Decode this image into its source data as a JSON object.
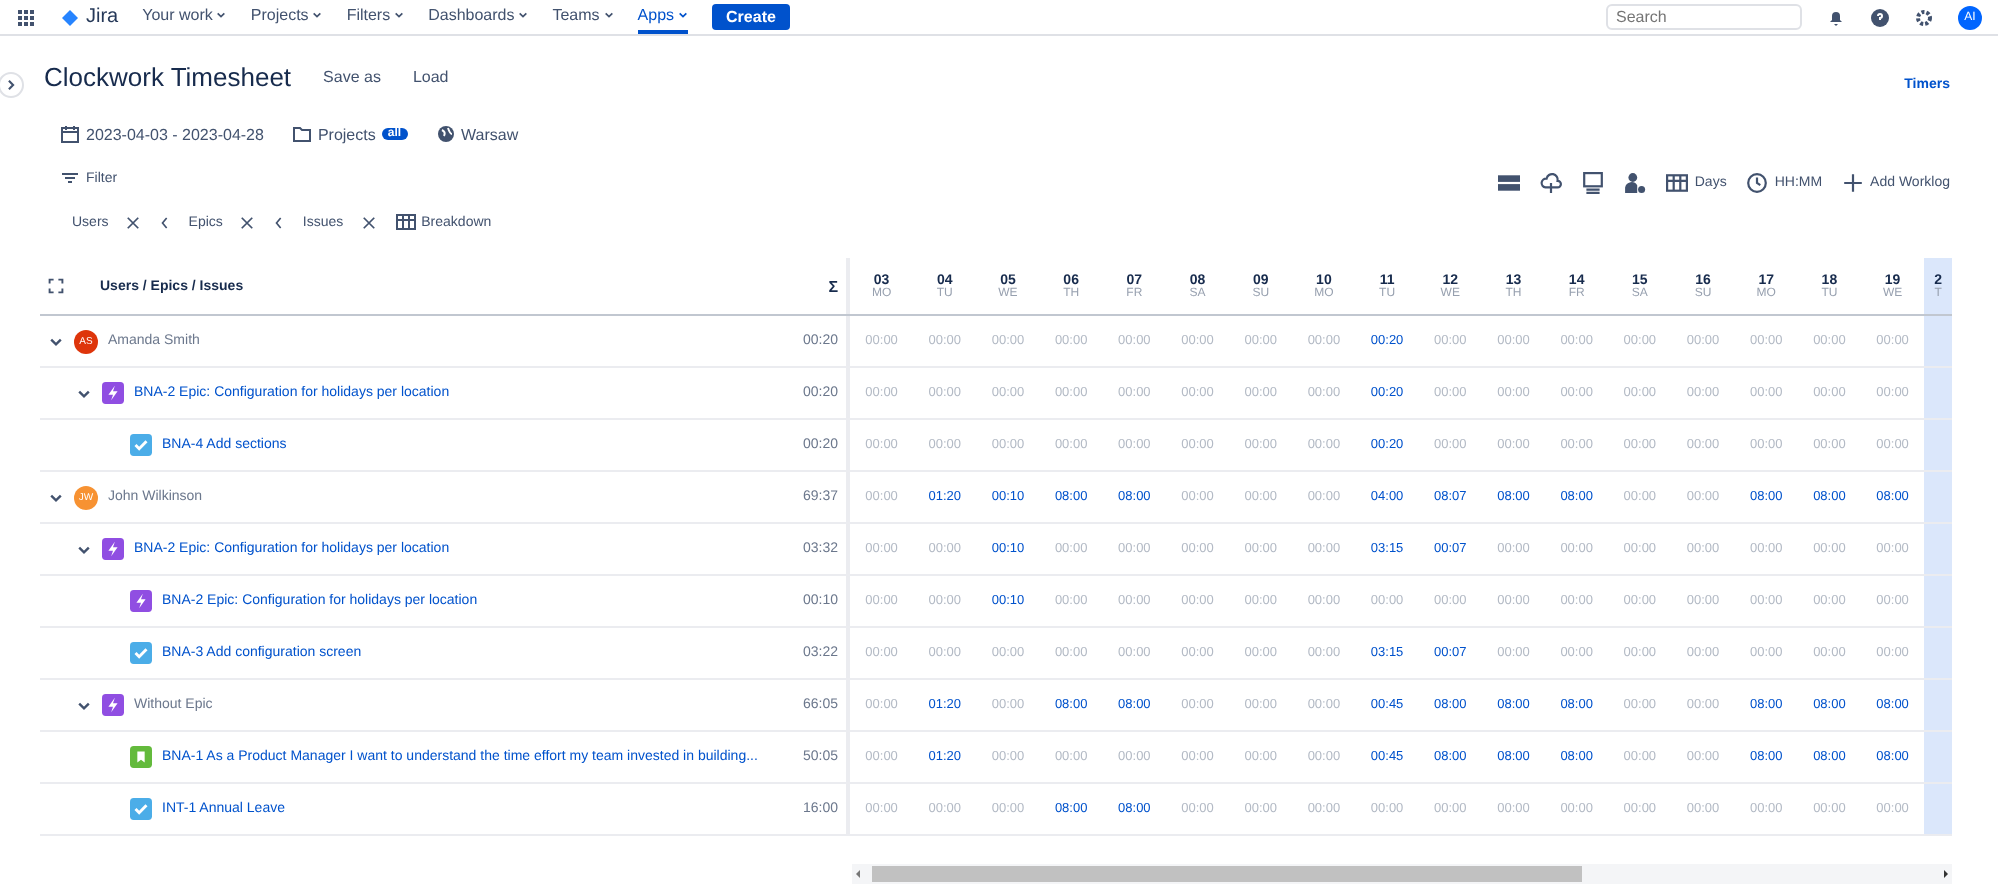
{
  "nav": {
    "product": "Jira",
    "items": [
      {
        "label": "Your work",
        "selected": false
      },
      {
        "label": "Projects",
        "selected": false
      },
      {
        "label": "Filters",
        "selected": false
      },
      {
        "label": "Dashboards",
        "selected": false
      },
      {
        "label": "Teams",
        "selected": false
      },
      {
        "label": "Apps",
        "selected": true
      }
    ],
    "create": "Create",
    "search": {
      "placeholder": "Search"
    },
    "avatar": "AI"
  },
  "header": {
    "title": "Clockwork Timesheet",
    "actions": [
      "Save as",
      "Load"
    ],
    "timers": "Timers"
  },
  "scope": {
    "date_range": "2023-04-03 - 2023-04-28",
    "projects": "Projects",
    "projects_badge": "all",
    "timezone": "Warsaw"
  },
  "filter": "Filter",
  "chips": [
    {
      "label": "Users",
      "has_arrow": false
    },
    {
      "label": "Epics",
      "has_arrow": true
    },
    {
      "label": "Issues",
      "has_arrow": true
    }
  ],
  "breakdown": "Breakdown",
  "toolbar": {
    "days": "Days",
    "format": "HH:MM",
    "add": "Add Worklog"
  },
  "table": {
    "heading": "Users / Epics / Issues",
    "sum_symbol": "Σ",
    "days": [
      {
        "day": "03",
        "weekday": "MO",
        "today": false
      },
      {
        "day": "04",
        "weekday": "TU",
        "today": false
      },
      {
        "day": "05",
        "weekday": "WE",
        "today": false
      },
      {
        "day": "06",
        "weekday": "TH",
        "today": false
      },
      {
        "day": "07",
        "weekday": "FR",
        "today": false
      },
      {
        "day": "08",
        "weekday": "SA",
        "today": false
      },
      {
        "day": "09",
        "weekday": "SU",
        "today": false
      },
      {
        "day": "10",
        "weekday": "MO",
        "today": false
      },
      {
        "day": "11",
        "weekday": "TU",
        "today": false
      },
      {
        "day": "12",
        "weekday": "WE",
        "today": false
      },
      {
        "day": "13",
        "weekday": "TH",
        "today": false
      },
      {
        "day": "14",
        "weekday": "FR",
        "today": false
      },
      {
        "day": "15",
        "weekday": "SA",
        "today": false
      },
      {
        "day": "16",
        "weekday": "SU",
        "today": false
      },
      {
        "day": "17",
        "weekday": "MO",
        "today": false
      },
      {
        "day": "18",
        "weekday": "TU",
        "today": false
      },
      {
        "day": "19",
        "weekday": "WE",
        "today": false
      },
      {
        "day": "2",
        "weekday": "T",
        "today": true
      }
    ],
    "rows": [
      {
        "kind": "user",
        "title": "Amanda Smith",
        "initials": "AS",
        "color": "#de350b",
        "total": "00:20",
        "expanded": true,
        "cells": [
          {
            "time": "00:00",
            "logged": false
          },
          {
            "time": "00:00",
            "logged": false
          },
          {
            "time": "00:00",
            "logged": false
          },
          {
            "time": "00:00",
            "logged": false
          },
          {
            "time": "00:00",
            "logged": false
          },
          {
            "time": "00:00",
            "logged": false
          },
          {
            "time": "00:00",
            "logged": false
          },
          {
            "time": "00:00",
            "logged": false
          },
          {
            "time": "00:20",
            "logged": true
          },
          {
            "time": "00:00",
            "logged": false
          },
          {
            "time": "00:00",
            "logged": false
          },
          {
            "time": "00:00",
            "logged": false
          },
          {
            "time": "00:00",
            "logged": false
          },
          {
            "time": "00:00",
            "logged": false
          },
          {
            "time": "00:00",
            "logged": false
          },
          {
            "time": "00:00",
            "logged": false
          },
          {
            "time": "00:00",
            "logged": false
          }
        ],
        "children": [
          {
            "kind": "epic",
            "title": "BNA-2 Epic: Configuration for holidays per location",
            "total": "00:20",
            "expanded": true,
            "cells": [
              {
                "time": "00:00",
                "logged": false
              },
              {
                "time": "00:00",
                "logged": false
              },
              {
                "time": "00:00",
                "logged": false
              },
              {
                "time": "00:00",
                "logged": false
              },
              {
                "time": "00:00",
                "logged": false
              },
              {
                "time": "00:00",
                "logged": false
              },
              {
                "time": "00:00",
                "logged": false
              },
              {
                "time": "00:00",
                "logged": false
              },
              {
                "time": "00:20",
                "logged": true
              },
              {
                "time": "00:00",
                "logged": false
              },
              {
                "time": "00:00",
                "logged": false
              },
              {
                "time": "00:00",
                "logged": false
              },
              {
                "time": "00:00",
                "logged": false
              },
              {
                "time": "00:00",
                "logged": false
              },
              {
                "time": "00:00",
                "logged": false
              },
              {
                "time": "00:00",
                "logged": false
              },
              {
                "time": "00:00",
                "logged": false
              }
            ],
            "children": [
              {
                "kind": "task",
                "title": "BNA-4 Add sections",
                "total": "00:20",
                "cells": [
                  {
                    "time": "00:00",
                    "logged": false
                  },
                  {
                    "time": "00:00",
                    "logged": false
                  },
                  {
                    "time": "00:00",
                    "logged": false
                  },
                  {
                    "time": "00:00",
                    "logged": false
                  },
                  {
                    "time": "00:00",
                    "logged": false
                  },
                  {
                    "time": "00:00",
                    "logged": false
                  },
                  {
                    "time": "00:00",
                    "logged": false
                  },
                  {
                    "time": "00:00",
                    "logged": false
                  },
                  {
                    "time": "00:20",
                    "logged": true
                  },
                  {
                    "time": "00:00",
                    "logged": false
                  },
                  {
                    "time": "00:00",
                    "logged": false
                  },
                  {
                    "time": "00:00",
                    "logged": false
                  },
                  {
                    "time": "00:00",
                    "logged": false
                  },
                  {
                    "time": "00:00",
                    "logged": false
                  },
                  {
                    "time": "00:00",
                    "logged": false
                  },
                  {
                    "time": "00:00",
                    "logged": false
                  },
                  {
                    "time": "00:00",
                    "logged": false
                  }
                ]
              }
            ]
          }
        ]
      },
      {
        "kind": "user",
        "title": "John Wilkinson",
        "initials": "JW",
        "color": "#f79232",
        "total": "69:37",
        "expanded": true,
        "cells": [
          {
            "time": "00:00",
            "logged": false
          },
          {
            "time": "01:20",
            "logged": true
          },
          {
            "time": "00:10",
            "logged": true
          },
          {
            "time": "08:00",
            "logged": true
          },
          {
            "time": "08:00",
            "logged": true
          },
          {
            "time": "00:00",
            "logged": false
          },
          {
            "time": "00:00",
            "logged": false
          },
          {
            "time": "00:00",
            "logged": false
          },
          {
            "time": "04:00",
            "logged": true
          },
          {
            "time": "08:07",
            "logged": true
          },
          {
            "time": "08:00",
            "logged": true
          },
          {
            "time": "08:00",
            "logged": true
          },
          {
            "time": "00:00",
            "logged": false
          },
          {
            "time": "00:00",
            "logged": false
          },
          {
            "time": "08:00",
            "logged": true
          },
          {
            "time": "08:00",
            "logged": true
          },
          {
            "time": "08:00",
            "logged": true
          }
        ],
        "children": [
          {
            "kind": "epic",
            "title": "BNA-2 Epic: Configuration for holidays per location",
            "total": "03:32",
            "expanded": true,
            "cells": [
              {
                "time": "00:00",
                "logged": false
              },
              {
                "time": "00:00",
                "logged": false
              },
              {
                "time": "00:10",
                "logged": true
              },
              {
                "time": "00:00",
                "logged": false
              },
              {
                "time": "00:00",
                "logged": false
              },
              {
                "time": "00:00",
                "logged": false
              },
              {
                "time": "00:00",
                "logged": false
              },
              {
                "time": "00:00",
                "logged": false
              },
              {
                "time": "03:15",
                "logged": true
              },
              {
                "time": "00:07",
                "logged": true
              },
              {
                "time": "00:00",
                "logged": false
              },
              {
                "time": "00:00",
                "logged": false
              },
              {
                "time": "00:00",
                "logged": false
              },
              {
                "time": "00:00",
                "logged": false
              },
              {
                "time": "00:00",
                "logged": false
              },
              {
                "time": "00:00",
                "logged": false
              },
              {
                "time": "00:00",
                "logged": false
              }
            ],
            "children": [
              {
                "kind": "epic",
                "title": "BNA-2 Epic: Configuration for holidays per location",
                "total": "00:10",
                "cells": [
                  {
                    "time": "00:00",
                    "logged": false
                  },
                  {
                    "time": "00:00",
                    "logged": false
                  },
                  {
                    "time": "00:10",
                    "logged": true
                  },
                  {
                    "time": "00:00",
                    "logged": false
                  },
                  {
                    "time": "00:00",
                    "logged": false
                  },
                  {
                    "time": "00:00",
                    "logged": false
                  },
                  {
                    "time": "00:00",
                    "logged": false
                  },
                  {
                    "time": "00:00",
                    "logged": false
                  },
                  {
                    "time": "00:00",
                    "logged": false
                  },
                  {
                    "time": "00:00",
                    "logged": false
                  },
                  {
                    "time": "00:00",
                    "logged": false
                  },
                  {
                    "time": "00:00",
                    "logged": false
                  },
                  {
                    "time": "00:00",
                    "logged": false
                  },
                  {
                    "time": "00:00",
                    "logged": false
                  },
                  {
                    "time": "00:00",
                    "logged": false
                  },
                  {
                    "time": "00:00",
                    "logged": false
                  },
                  {
                    "time": "00:00",
                    "logged": false
                  }
                ]
              },
              {
                "kind": "task",
                "title": "BNA-3 Add configuration screen",
                "total": "03:22",
                "cells": [
                  {
                    "time": "00:00",
                    "logged": false
                  },
                  {
                    "time": "00:00",
                    "logged": false
                  },
                  {
                    "time": "00:00",
                    "logged": false
                  },
                  {
                    "time": "00:00",
                    "logged": false
                  },
                  {
                    "time": "00:00",
                    "logged": false
                  },
                  {
                    "time": "00:00",
                    "logged": false
                  },
                  {
                    "time": "00:00",
                    "logged": false
                  },
                  {
                    "time": "00:00",
                    "logged": false
                  },
                  {
                    "time": "03:15",
                    "logged": true
                  },
                  {
                    "time": "00:07",
                    "logged": true
                  },
                  {
                    "time": "00:00",
                    "logged": false
                  },
                  {
                    "time": "00:00",
                    "logged": false
                  },
                  {
                    "time": "00:00",
                    "logged": false
                  },
                  {
                    "time": "00:00",
                    "logged": false
                  },
                  {
                    "time": "00:00",
                    "logged": false
                  },
                  {
                    "time": "00:00",
                    "logged": false
                  },
                  {
                    "time": "00:00",
                    "logged": false
                  }
                ]
              }
            ]
          },
          {
            "kind": "no-epic",
            "title": "Without Epic",
            "total": "66:05",
            "expanded": true,
            "cells": [
              {
                "time": "00:00",
                "logged": false
              },
              {
                "time": "01:20",
                "logged": true
              },
              {
                "time": "00:00",
                "logged": false
              },
              {
                "time": "08:00",
                "logged": true
              },
              {
                "time": "08:00",
                "logged": true
              },
              {
                "time": "00:00",
                "logged": false
              },
              {
                "time": "00:00",
                "logged": false
              },
              {
                "time": "00:00",
                "logged": false
              },
              {
                "time": "00:45",
                "logged": true
              },
              {
                "time": "08:00",
                "logged": true
              },
              {
                "time": "08:00",
                "logged": true
              },
              {
                "time": "08:00",
                "logged": true
              },
              {
                "time": "00:00",
                "logged": false
              },
              {
                "time": "00:00",
                "logged": false
              },
              {
                "time": "08:00",
                "logged": true
              },
              {
                "time": "08:00",
                "logged": true
              },
              {
                "time": "08:00",
                "logged": true
              }
            ],
            "children": [
              {
                "kind": "story",
                "title": "BNA-1 As a Product Manager I want to understand the time effort my team invested in building...",
                "total": "50:05",
                "cells": [
                  {
                    "time": "00:00",
                    "logged": false
                  },
                  {
                    "time": "01:20",
                    "logged": true
                  },
                  {
                    "time": "00:00",
                    "logged": false
                  },
                  {
                    "time": "00:00",
                    "logged": false
                  },
                  {
                    "time": "00:00",
                    "logged": false
                  },
                  {
                    "time": "00:00",
                    "logged": false
                  },
                  {
                    "time": "00:00",
                    "logged": false
                  },
                  {
                    "time": "00:00",
                    "logged": false
                  },
                  {
                    "time": "00:45",
                    "logged": true
                  },
                  {
                    "time": "08:00",
                    "logged": true
                  },
                  {
                    "time": "08:00",
                    "logged": true
                  },
                  {
                    "time": "08:00",
                    "logged": true
                  },
                  {
                    "time": "00:00",
                    "logged": false
                  },
                  {
                    "time": "00:00",
                    "logged": false
                  },
                  {
                    "time": "08:00",
                    "logged": true
                  },
                  {
                    "time": "08:00",
                    "logged": true
                  },
                  {
                    "time": "08:00",
                    "logged": true
                  }
                ]
              },
              {
                "kind": "task",
                "title": "INT-1 Annual Leave",
                "total": "16:00",
                "cells": [
                  {
                    "time": "00:00",
                    "logged": false
                  },
                  {
                    "time": "00:00",
                    "logged": false
                  },
                  {
                    "time": "00:00",
                    "logged": false
                  },
                  {
                    "time": "08:00",
                    "logged": true
                  },
                  {
                    "time": "08:00",
                    "logged": true
                  },
                  {
                    "time": "00:00",
                    "logged": false
                  },
                  {
                    "time": "00:00",
                    "logged": false
                  },
                  {
                    "time": "00:00",
                    "logged": false
                  },
                  {
                    "time": "00:00",
                    "logged": false
                  },
                  {
                    "time": "00:00",
                    "logged": false
                  },
                  {
                    "time": "00:00",
                    "logged": false
                  },
                  {
                    "time": "00:00",
                    "logged": false
                  },
                  {
                    "time": "00:00",
                    "logged": false
                  },
                  {
                    "time": "00:00",
                    "logged": false
                  },
                  {
                    "time": "00:00",
                    "logged": false
                  },
                  {
                    "time": "00:00",
                    "logged": false
                  },
                  {
                    "time": "00:00",
                    "logged": false
                  }
                ]
              }
            ]
          }
        ]
      }
    ]
  }
}
